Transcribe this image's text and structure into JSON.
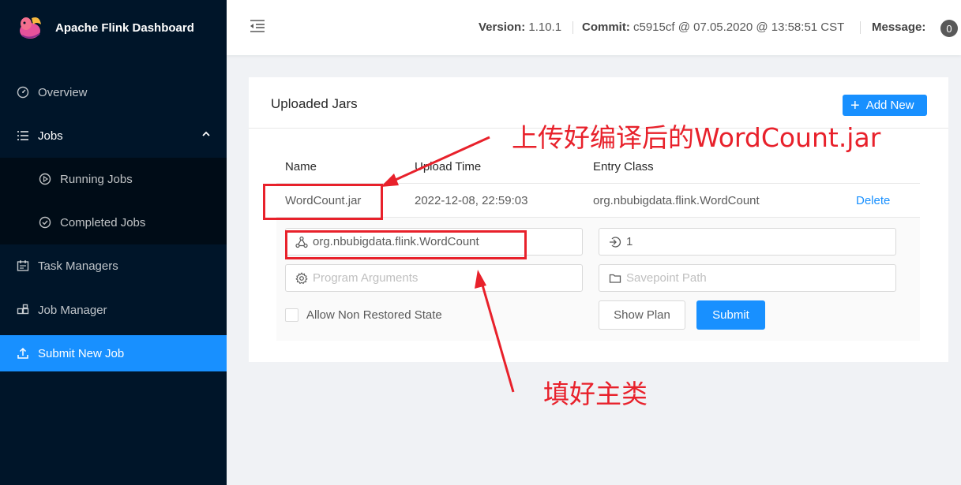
{
  "app": {
    "title": "Apache Flink Dashboard"
  },
  "sidebar": {
    "items": [
      {
        "label": "Overview",
        "icon": "dashboard-icon"
      },
      {
        "label": "Jobs",
        "icon": "list-icon"
      },
      {
        "label": "Running Jobs",
        "icon": "play-circle-icon"
      },
      {
        "label": "Completed Jobs",
        "icon": "check-circle-icon"
      },
      {
        "label": "Task Managers",
        "icon": "schedule-icon"
      },
      {
        "label": "Job Manager",
        "icon": "build-icon"
      },
      {
        "label": "Submit New Job",
        "icon": "upload-icon"
      }
    ]
  },
  "header": {
    "version_label": "Version:",
    "version": "1.10.1",
    "commit_label": "Commit:",
    "commit": "c5915cf @ 07.05.2020 @ 13:58:51 CST",
    "message_label": "Message:",
    "message_count": "0"
  },
  "card": {
    "title": "Uploaded Jars",
    "add_button": "Add New",
    "columns": [
      "Name",
      "Upload Time",
      "Entry Class"
    ],
    "row": {
      "name": "WordCount.jar",
      "upload_time": "2022-12-08, 22:59:03",
      "entry_class": "org.nbubigdata.flink.WordCount",
      "delete_label": "Delete"
    },
    "form": {
      "entry_class_value": "org.nbubigdata.flink.WordCount",
      "parallelism_value": "1",
      "program_args_placeholder": "Program Arguments",
      "savepoint_placeholder": "Savepoint Path",
      "allow_non_restored_label": "Allow Non Restored State",
      "show_plan_label": "Show Plan",
      "submit_label": "Submit"
    }
  },
  "annotations": {
    "jar_note": "上传好编译后的WordCount.jar",
    "class_note": "填好主类"
  },
  "colors": {
    "sidebar": "#001529",
    "accent": "#1890ff",
    "annotation": "#e8212b"
  }
}
